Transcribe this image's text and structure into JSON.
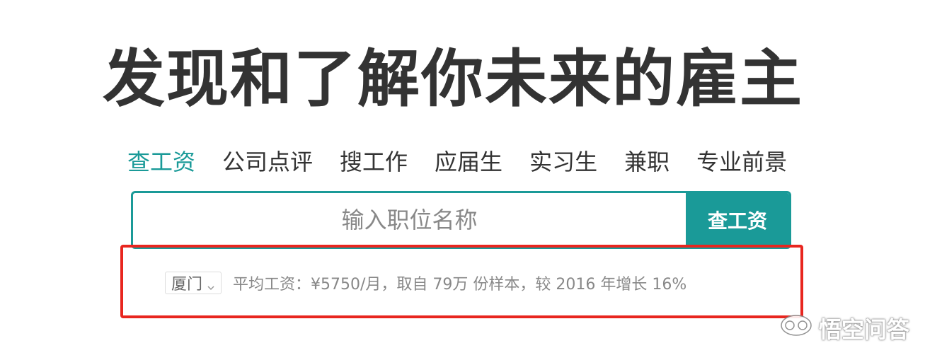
{
  "hero": {
    "title": "发现和了解你未来的雇主"
  },
  "tabs": [
    {
      "label": "查工资",
      "active": true
    },
    {
      "label": "公司点评",
      "active": false
    },
    {
      "label": "搜工作",
      "active": false
    },
    {
      "label": "应届生",
      "active": false
    },
    {
      "label": "实习生",
      "active": false
    },
    {
      "label": "兼职",
      "active": false
    },
    {
      "label": "专业前景",
      "active": false
    }
  ],
  "search": {
    "placeholder": "输入职位名称",
    "value": "",
    "button_label": "查工资"
  },
  "stats": {
    "city": "厦门",
    "text": "平均工资：¥5750/月，取自 79万 份样本，较 2016 年增长 16%"
  },
  "watermark": {
    "text": "悟空问答"
  },
  "colors": {
    "accent": "#1a9a98",
    "highlight": "#e8261f",
    "title": "#333333",
    "muted": "#888888"
  },
  "icons": {
    "city_dropdown": "chevron-down-icon",
    "watermark_logo": "wukong-logo-icon"
  }
}
